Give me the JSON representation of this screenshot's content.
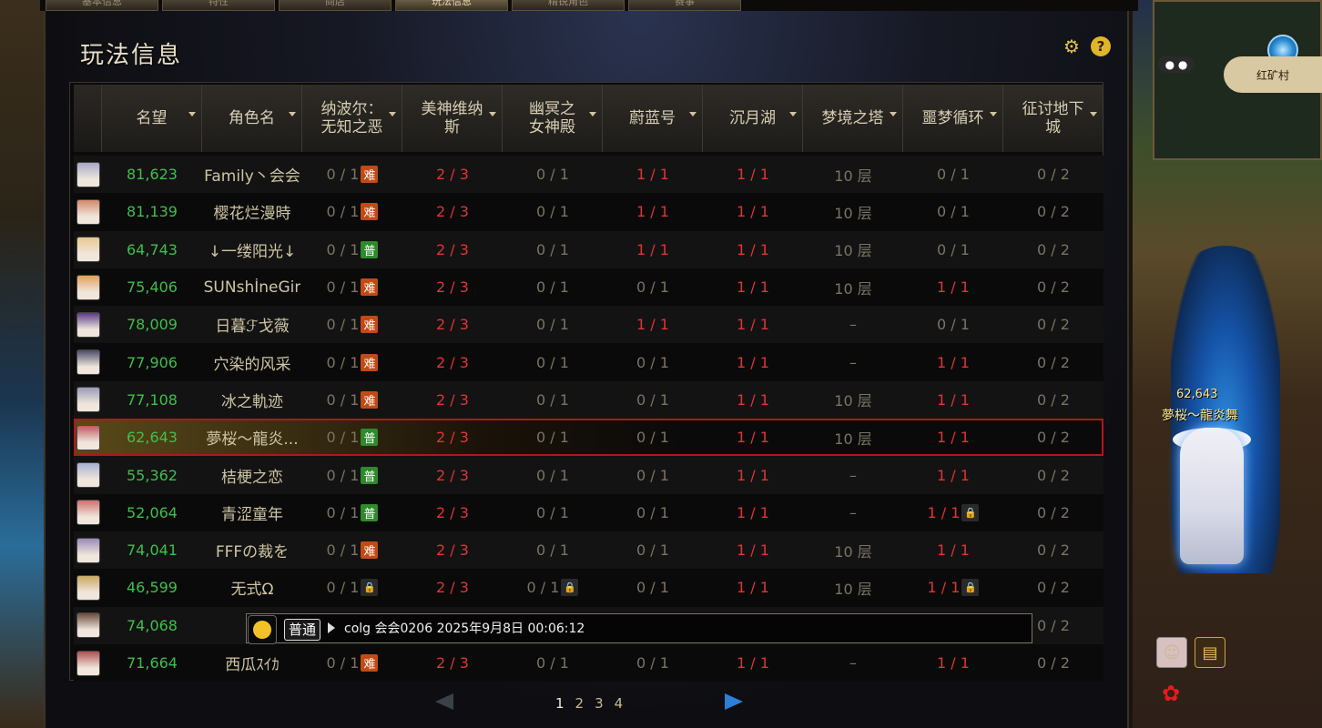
{
  "tabs": [
    "基本信息",
    "特性",
    "商店",
    "玩法信息",
    "精锐角色",
    "赛事"
  ],
  "active_tab_index": 3,
  "title": "玩法信息",
  "icons": {
    "settings": "gear-icon",
    "help": "help-icon"
  },
  "columns": [
    "",
    "名望",
    "角色名",
    "纳波尔：\n无知之恶",
    "美神维纳\n斯",
    "幽冥之\n女神殿",
    "蔚蓝号",
    "沉月湖",
    "梦境之塔",
    "噩梦循环",
    "征讨地下\n城"
  ],
  "badges": {
    "hard": "难",
    "normal": "普"
  },
  "rows": [
    {
      "avatar_color": "#a8a8c8",
      "fame": "81,623",
      "name": "Family丶会会",
      "naboer": "0 / 1",
      "nb": "hard",
      "venus": "2 / 3",
      "underworld": "0 / 1",
      "azure": "1 / 1",
      "moonlake": "1 / 1",
      "dream": "10 层",
      "nightmare": "0 / 1",
      "dungeon": "0 / 2"
    },
    {
      "avatar_color": "#d08a6a",
      "fame": "81,139",
      "name": "樱花烂漫時",
      "naboer": "0 / 1",
      "nb": "hard",
      "venus": "2 / 3",
      "underworld": "0 / 1",
      "azure": "1 / 1",
      "moonlake": "1 / 1",
      "dream": "10 层",
      "nightmare": "0 / 1",
      "dungeon": "0 / 2"
    },
    {
      "avatar_color": "#e8c890",
      "fame": "64,743",
      "name": "↓一缕阳光↓",
      "naboer": "0 / 1",
      "nb": "normal",
      "venus": "2 / 3",
      "underworld": "0 / 1",
      "azure": "1 / 1",
      "moonlake": "1 / 1",
      "dream": "10 层",
      "nightmare": "0 / 1",
      "dungeon": "0 / 2"
    },
    {
      "avatar_color": "#e0a060",
      "fame": "75,406",
      "name": "SUNshİneGir",
      "naboer": "0 / 1",
      "nb": "hard",
      "venus": "2 / 3",
      "underworld": "0 / 1",
      "azure": "0 / 1",
      "moonlake": "1 / 1",
      "dream": "10 层",
      "nightmare": "1 / 1",
      "dungeon": "0 / 2"
    },
    {
      "avatar_color": "#5a3a8a",
      "fame": "78,009",
      "name": "日暮ℱ戈薇",
      "naboer": "0 / 1",
      "nb": "hard",
      "venus": "2 / 3",
      "underworld": "0 / 1",
      "azure": "1 / 1",
      "moonlake": "1 / 1",
      "dream": "–",
      "nightmare": "0 / 1",
      "dungeon": "0 / 2"
    },
    {
      "avatar_color": "#4a4a6a",
      "fame": "77,906",
      "name": "穴染的风采",
      "naboer": "0 / 1",
      "nb": "hard",
      "venus": "2 / 3",
      "underworld": "0 / 1",
      "azure": "0 / 1",
      "moonlake": "1 / 1",
      "dream": "–",
      "nightmare": "1 / 1",
      "dungeon": "0 / 2"
    },
    {
      "avatar_color": "#9a9ab8",
      "fame": "77,108",
      "name": "冰之軌迹",
      "naboer": "0 / 1",
      "nb": "hard",
      "venus": "2 / 3",
      "underworld": "0 / 1",
      "azure": "0 / 1",
      "moonlake": "1 / 1",
      "dream": "10 层",
      "nightmare": "1 / 1",
      "dungeon": "0 / 2"
    },
    {
      "avatar_color": "#c05a5a",
      "fame": "62,643",
      "name": "夢桜〜龍炎...",
      "naboer": "0 / 1",
      "nb": "normal",
      "venus": "2 / 3",
      "underworld": "0 / 1",
      "azure": "0 / 1",
      "moonlake": "1 / 1",
      "dream": "10 层",
      "nightmare": "1 / 1",
      "dungeon": "0 / 2",
      "selected": true
    },
    {
      "avatar_color": "#a8b0d0",
      "fame": "55,362",
      "name": "桔梗之恋",
      "naboer": "0 / 1",
      "nb": "normal",
      "venus": "2 / 3",
      "underworld": "0 / 1",
      "azure": "0 / 1",
      "moonlake": "1 / 1",
      "dream": "–",
      "nightmare": "1 / 1",
      "dungeon": "0 / 2"
    },
    {
      "avatar_color": "#d07070",
      "fame": "52,064",
      "name": "青涩童年",
      "naboer": "0 / 1",
      "nb": "normal",
      "venus": "2 / 3",
      "underworld": "0 / 1",
      "azure": "0 / 1",
      "moonlake": "1 / 1",
      "dream": "–",
      "nightmare": "1 / 1",
      "nightmare_lock": true,
      "dungeon": "0 / 2"
    },
    {
      "avatar_color": "#9a8ab8",
      "fame": "74,041",
      "name": "FFFの裁を",
      "naboer": "0 / 1",
      "nb": "hard",
      "venus": "2 / 3",
      "underworld": "0 / 1",
      "azure": "0 / 1",
      "moonlake": "1 / 1",
      "dream": "10 层",
      "nightmare": "1 / 1",
      "dungeon": "0 / 2"
    },
    {
      "avatar_color": "#c8a860",
      "fame": "46,599",
      "name": "无式Ω",
      "naboer": "0 / 1",
      "nb": "lock",
      "venus": "2 / 3",
      "underworld": "0 / 1",
      "underworld_lock": true,
      "azure": "0 / 1",
      "moonlake": "1 / 1",
      "dream": "10 层",
      "nightmare": "1 / 1",
      "nightmare_lock": true,
      "dungeon": "0 / 2"
    },
    {
      "avatar_color": "#6a4a3a",
      "fame": "74,068",
      "name": "日",
      "naboer": "",
      "nb": "",
      "venus": "",
      "underworld": "",
      "azure": "",
      "moonlake": "",
      "dream": "",
      "nightmare": "",
      "dungeon": "0 / 2"
    },
    {
      "avatar_color": "#b05050",
      "fame": "71,664",
      "name": "西瓜ｽｲｶ",
      "naboer": "0 / 1",
      "nb": "hard",
      "venus": "2 / 3",
      "underworld": "0 / 1",
      "azure": "0 / 1",
      "moonlake": "1 / 1",
      "dream": "–",
      "nightmare": "1 / 1",
      "dungeon": "0 / 2"
    }
  ],
  "chat": {
    "mode": "普通",
    "text": "colg 会会0206  2025年9月8日  00:06:12"
  },
  "pager": {
    "pages": [
      "1",
      "2",
      "3",
      "4"
    ],
    "current": "1"
  },
  "scene": {
    "char_score": "62,643",
    "char_name": "夢桜〜龍炎舞",
    "map_label": "红矿村"
  }
}
